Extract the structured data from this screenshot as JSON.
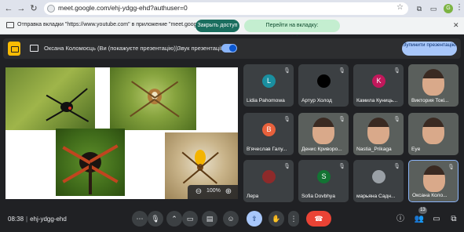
{
  "browser": {
    "url": "meet.google.com/ehj-ydgg-ehd?authuser=0",
    "profile_initial": "G"
  },
  "infobar": {
    "message": "Отправка вкладки \"https://www.youtube.com\" в приложение \"meet.google.com\"...",
    "stop_label": "Закрыть доступ",
    "switch_label": "Перейти на вкладку: www.youtube.com"
  },
  "presentation_bar": {
    "presenter_label": "Оксана Коломоєць (Ви (покажуєте презентацію))",
    "sound_label": "Звук презентації",
    "sound_on": true,
    "stop_label": "Зупинити презентацію"
  },
  "stage": {
    "zoom_level": "100%"
  },
  "participants": [
    {
      "name": "Lidia Pahomowa",
      "initial": "L",
      "color": "#1a8fa0",
      "muted": true,
      "video": false
    },
    {
      "name": "Артур Холод",
      "initial": "",
      "color": "#000000",
      "muted": true,
      "video": false
    },
    {
      "name": "Камила Куниць...",
      "initial": "K",
      "color": "#c2185b",
      "muted": true,
      "video": false
    },
    {
      "name": "Виктория Токі...",
      "initial": "",
      "color": "",
      "muted": false,
      "video": true
    },
    {
      "name": "В'ячеслав Галу...",
      "initial": "B",
      "color": "#e8613c",
      "muted": true,
      "video": false
    },
    {
      "name": "Денис Криворо...",
      "initial": "",
      "color": "",
      "muted": true,
      "video": true
    },
    {
      "name": "Nastia_Prikaga",
      "initial": "",
      "color": "",
      "muted": true,
      "video": true
    },
    {
      "name": "Eye",
      "initial": "",
      "color": "",
      "muted": false,
      "video": true
    },
    {
      "name": "Лера",
      "initial": "",
      "color": "#8d2a2a",
      "muted": true,
      "video": false
    },
    {
      "name": "Sofia Dovbhya",
      "initial": "S",
      "color": "#137333",
      "muted": true,
      "video": false
    },
    {
      "name": "марьяна Садн...",
      "initial": "",
      "color": "#9aa0a6",
      "muted": true,
      "video": false
    },
    {
      "name": "Оксана Коло...",
      "initial": "",
      "color": "",
      "muted": true,
      "video": true
    }
  ],
  "controls": {
    "time": "08:38",
    "meeting_code": "ehj-ydgg-ehd",
    "people_count": "13"
  }
}
